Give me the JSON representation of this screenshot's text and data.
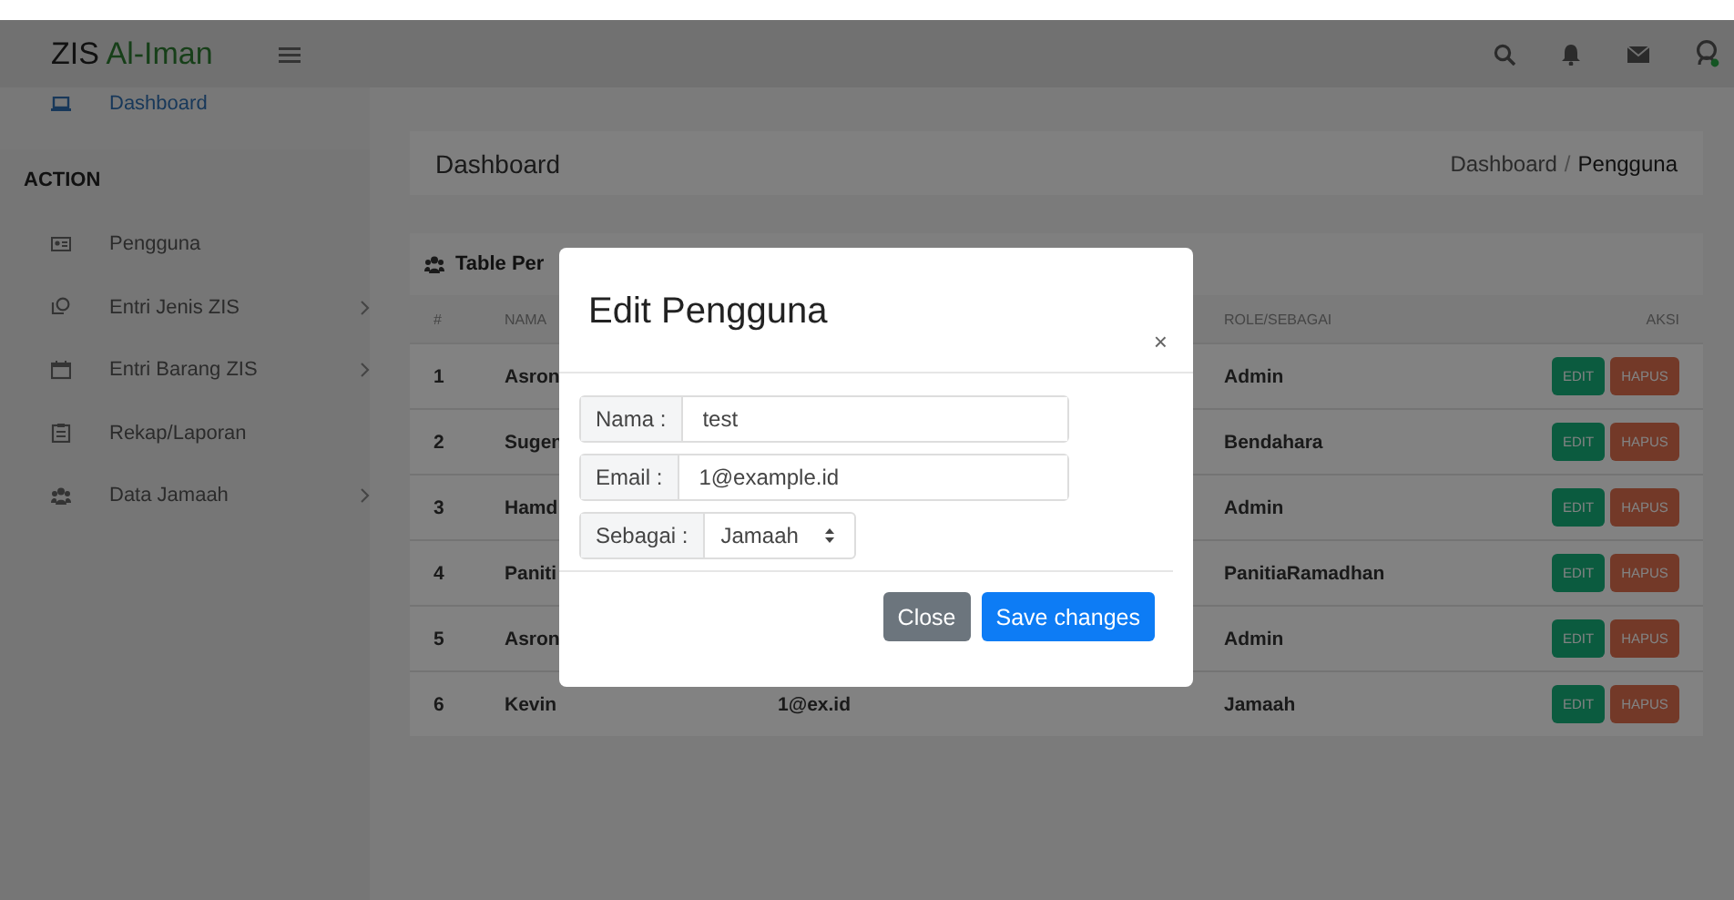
{
  "header": {
    "brand": "ZIS",
    "brand_accent": "Al-Iman",
    "user_online": true
  },
  "sidebar": {
    "top_items": [
      {
        "label": "Dashboard",
        "selected": true
      }
    ],
    "section": "ACTION",
    "items": [
      {
        "label": "Pengguna",
        "has_submenu": false
      },
      {
        "label": "Entri Jenis ZIS",
        "has_submenu": true
      },
      {
        "label": "Entri Barang ZIS",
        "has_submenu": true
      },
      {
        "label": "Rekap/Laporan",
        "has_submenu": false
      },
      {
        "label": "Data Jamaah",
        "has_submenu": true
      }
    ]
  },
  "breadcrumb": {
    "title": "Dashboard",
    "trail": [
      "Dashboard",
      "Pengguna"
    ],
    "separator": "/"
  },
  "table": {
    "title": "Table Per",
    "columns": [
      "#",
      "NAMA",
      "",
      "ROLE/SEBAGAI",
      "AKSI"
    ],
    "rows": [
      {
        "no": "1",
        "name": "Asron",
        "role": "Admin",
        "actions": [
          "EDIT",
          "HAPUS"
        ]
      },
      {
        "no": "2",
        "name": "Sugen",
        "role": "Bendahara",
        "actions": [
          "EDIT",
          "HAPUS"
        ]
      },
      {
        "no": "3",
        "name": "Hamd",
        "role": "Admin",
        "actions": [
          "EDIT",
          "HAPUS"
        ]
      },
      {
        "no": "4",
        "name": "Paniti",
        "role": "PanitiaRamadhan",
        "actions": [
          "EDIT",
          "HAPUS"
        ]
      },
      {
        "no": "5",
        "name": "Asron",
        "role": "Admin",
        "actions": [
          "EDIT",
          "HAPUS"
        ]
      },
      {
        "no": "6",
        "name": "Kevin",
        "email": "1@ex.id",
        "role": "Jamaah",
        "actions": [
          "EDIT",
          "HAPUS"
        ]
      }
    ]
  },
  "modal": {
    "title": "Edit Pengguna",
    "close": "×",
    "fields": [
      {
        "kind": "text",
        "label": "Nama :",
        "value": "test"
      },
      {
        "kind": "text",
        "label": "Email :",
        "value": "1@example.id"
      },
      {
        "kind": "select",
        "label": "Sebagai :",
        "value": "Jamaah"
      }
    ],
    "buttons": [
      {
        "label": "Close",
        "kind": "secondary"
      },
      {
        "label": "Save changes",
        "kind": "primary"
      }
    ]
  }
}
